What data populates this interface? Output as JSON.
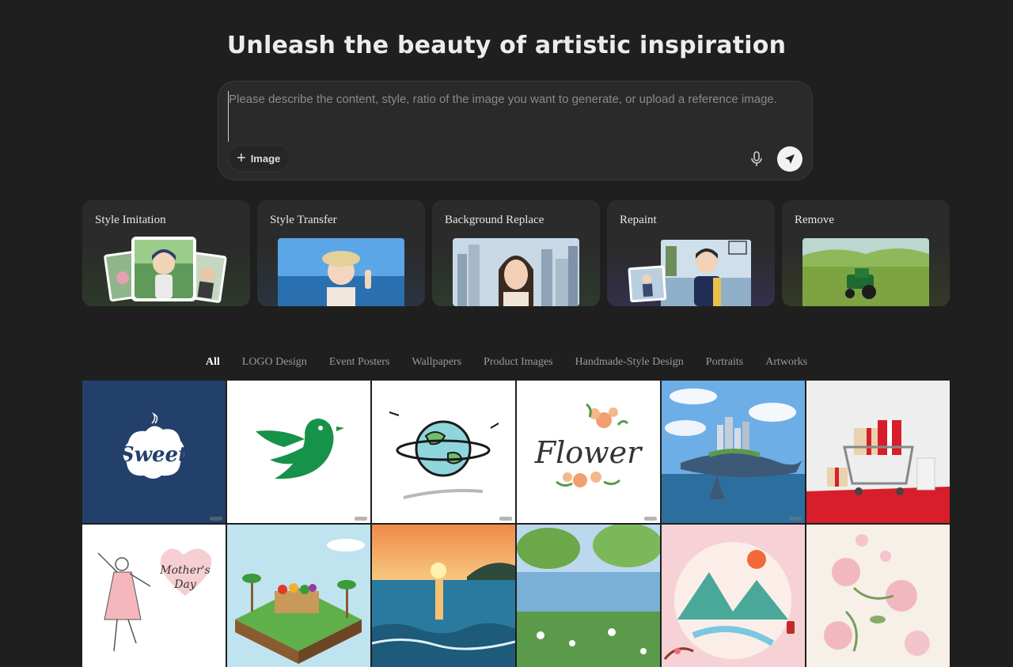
{
  "header": {
    "title": "Unleash the beauty of artistic inspiration"
  },
  "prompt": {
    "placeholder": "Please describe the content, style, ratio of the image you want to generate, or upload a reference image.",
    "image_button_label": "Image"
  },
  "tools": [
    {
      "label": "Style Imitation"
    },
    {
      "label": "Style Transfer"
    },
    {
      "label": "Background Replace"
    },
    {
      "label": "Repaint"
    },
    {
      "label": "Remove"
    }
  ],
  "filters": [
    "All",
    "LOGO Design",
    "Event Posters",
    "Wallpapers",
    "Product Images",
    "Handmade-Style Design",
    "Portraits",
    "Artworks"
  ],
  "filters_active": "All",
  "gallery": {
    "sweet_logo_text": "Sweet",
    "flower_logo_text": "Flower",
    "mothers_day_text_1": "Mother's",
    "mothers_day_text_2": "Day"
  },
  "colors": {
    "background": "#1f1f1f",
    "card": "#2b2b2b",
    "send_button": "#f2f2f2",
    "sweet_bg": "#22406b",
    "bird_green": "#16924a"
  }
}
